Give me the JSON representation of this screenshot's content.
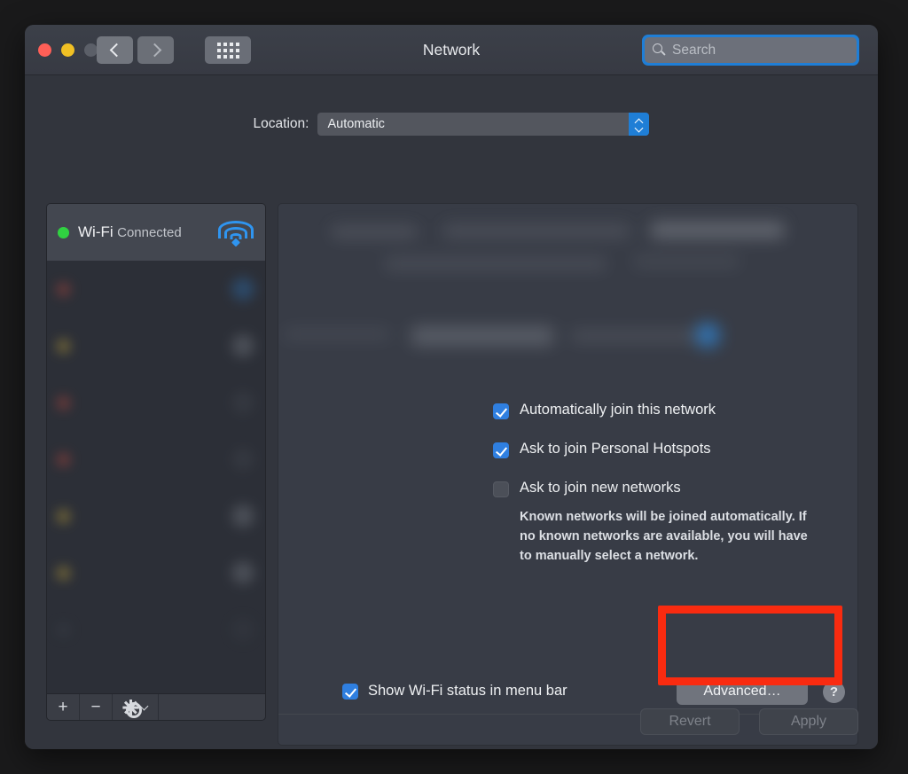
{
  "window": {
    "title": "Network",
    "traffic_lights": [
      "close",
      "minimize",
      "zoom"
    ],
    "nav": {
      "back_label": "Back",
      "forward_label": "Forward",
      "show_all_label": "Show All"
    },
    "search": {
      "placeholder": "Search",
      "value": "",
      "icon": "search-icon",
      "focus_color": "#1f7ed6"
    }
  },
  "location": {
    "label": "Location:",
    "selected": "Automatic",
    "options": [
      "Automatic"
    ]
  },
  "sidebar": {
    "selected_index": 0,
    "services": [
      {
        "name": "Wi-Fi",
        "status": "Connected",
        "status_color": "#30d241",
        "icon": "wifi-icon",
        "redacted": false
      },
      {
        "name": "",
        "status": "",
        "status_color": "#c94b3e",
        "redacted": true
      },
      {
        "name": "",
        "status": "",
        "status_color": "#d4b33a",
        "redacted": true
      },
      {
        "name": "",
        "status": "",
        "status_color": "#c94b3e",
        "redacted": true
      },
      {
        "name": "",
        "status": "",
        "status_color": "#c94b3e",
        "redacted": true
      },
      {
        "name": "",
        "status": "",
        "status_color": "#d4b33a",
        "redacted": true
      },
      {
        "name": "",
        "status": "",
        "status_color": "#d4b33a",
        "redacted": true
      },
      {
        "name": "",
        "status": "",
        "status_color": "#4a4e57",
        "redacted": true
      }
    ],
    "toolbar": {
      "add_label": "+",
      "remove_label": "−",
      "action_icon": "gear-icon",
      "action_chevron": "chevron-down-icon"
    }
  },
  "content": {
    "redacted_fields_note": "status and network name rows are blurred",
    "checkboxes": [
      {
        "label": "Automatically join this network",
        "checked": true
      },
      {
        "label": "Ask to join Personal Hotspots",
        "checked": true
      },
      {
        "label": "Ask to join new networks",
        "checked": false
      }
    ],
    "help_text": "Known networks will be joined automatically. If no known networks are available, you will have to manually select a network.",
    "menubar_checkbox": {
      "label": "Show Wi-Fi status in menu bar",
      "checked": true
    },
    "advanced_button": "Advanced…",
    "help_button": "?"
  },
  "footer": {
    "revert_label": "Revert",
    "apply_label": "Apply",
    "revert_enabled": false,
    "apply_enabled": false
  },
  "annotation": {
    "type": "highlight-box",
    "color": "#f92b10",
    "targets": [
      "advanced-button",
      "help-button"
    ]
  }
}
